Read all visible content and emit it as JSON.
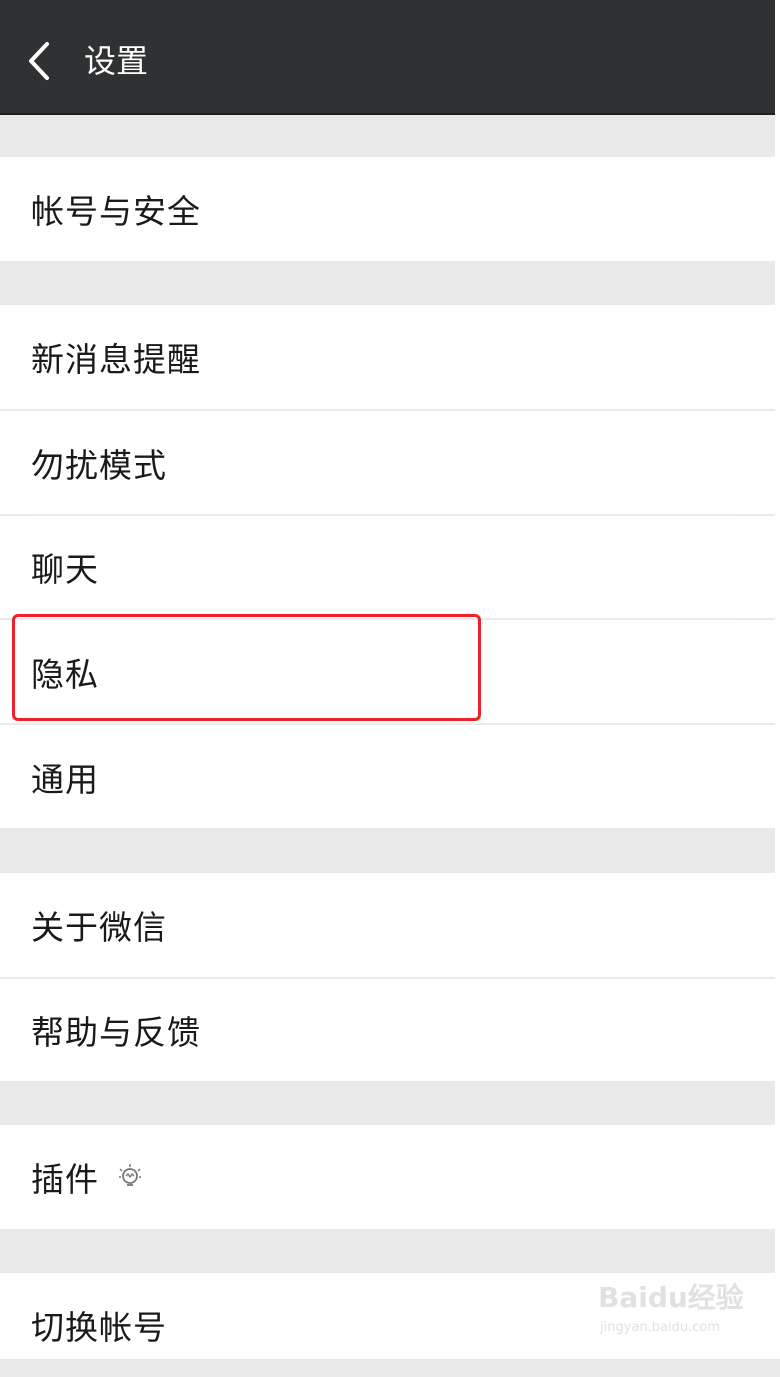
{
  "header": {
    "title": "设置"
  },
  "groups": [
    {
      "items": [
        {
          "label": "帐号与安全"
        }
      ]
    },
    {
      "items": [
        {
          "label": "新消息提醒"
        },
        {
          "label": "勿扰模式"
        },
        {
          "label": "聊天"
        },
        {
          "label": "隐私"
        },
        {
          "label": "通用"
        }
      ]
    },
    {
      "items": [
        {
          "label": "关于微信"
        },
        {
          "label": "帮助与反馈"
        }
      ]
    },
    {
      "items": [
        {
          "label": "插件"
        }
      ]
    },
    {
      "items": [
        {
          "label": "切换帐号"
        }
      ]
    }
  ],
  "highlight": {
    "target": "隐私",
    "color": "#f2202a"
  },
  "watermark": {
    "brand": "Baidu经验",
    "url": "jingyan.baidu.com"
  },
  "colors": {
    "header_bg": "#2f3133",
    "page_bg": "#e9e9e9",
    "row_bg": "#ffffff"
  }
}
